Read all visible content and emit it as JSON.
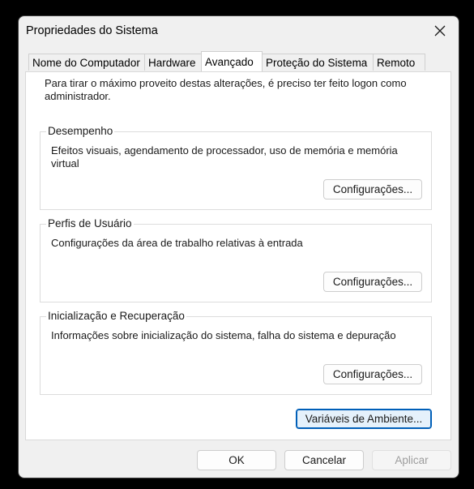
{
  "window": {
    "title": "Propriedades do Sistema"
  },
  "tabs": [
    {
      "label": "Nome do Computador"
    },
    {
      "label": "Hardware"
    },
    {
      "label": "Avançado"
    },
    {
      "label": "Proteção do Sistema"
    },
    {
      "label": "Remoto"
    }
  ],
  "active_tab": "Avançado",
  "intro": "Para tirar o máximo proveito destas alterações, é preciso ter feito logon como administrador.",
  "groups": {
    "performance": {
      "title": "Desempenho",
      "description": "Efeitos visuais, agendamento de processador, uso de memória e memória virtual",
      "button": "Configurações..."
    },
    "profiles": {
      "title": "Perfis de Usuário",
      "description": "Configurações da área de trabalho relativas à entrada",
      "button": "Configurações..."
    },
    "startup": {
      "title": "Inicialização e Recuperação",
      "description": "Informações sobre inicialização do sistema, falha do sistema e depuração",
      "button": "Configurações..."
    }
  },
  "env_button": "Variáveis de Ambiente...",
  "footer": {
    "ok": "OK",
    "cancel": "Cancelar",
    "apply": "Aplicar"
  }
}
